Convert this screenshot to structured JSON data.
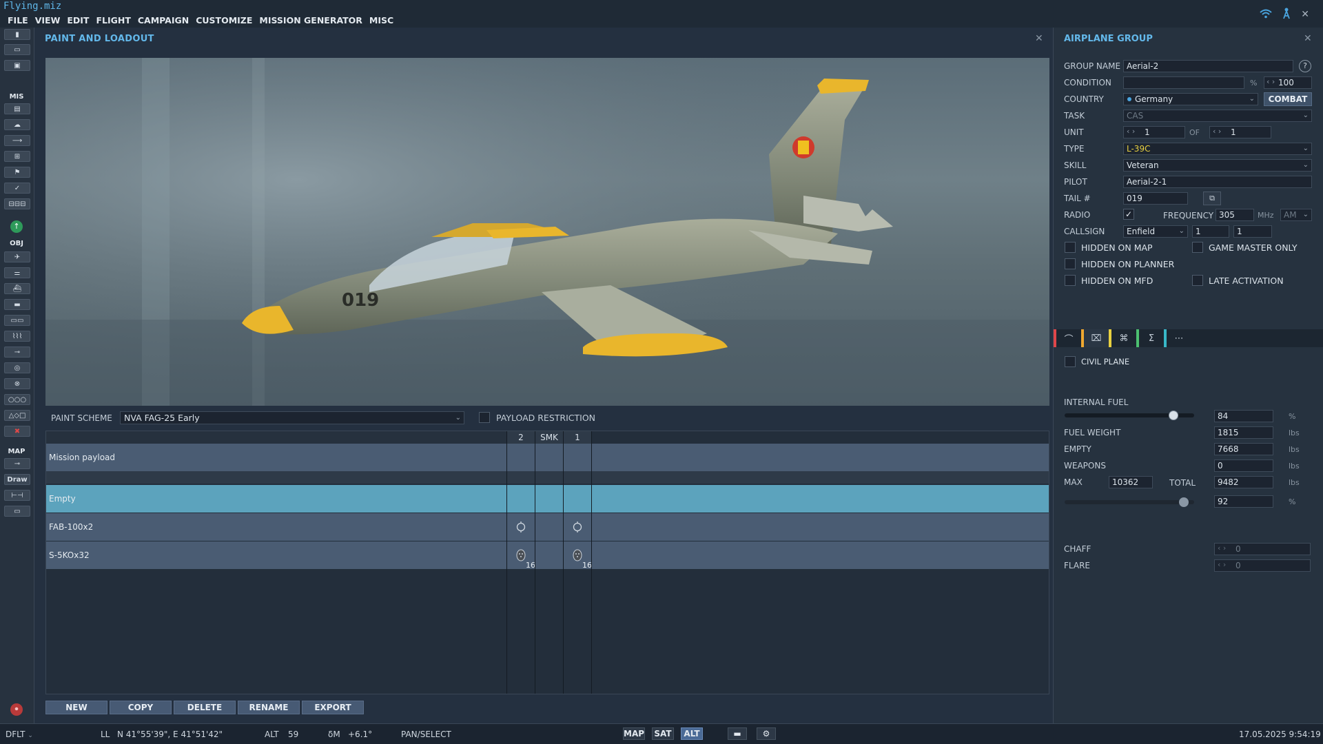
{
  "app": {
    "title": "Flying.miz"
  },
  "menu": [
    "FILE",
    "VIEW",
    "EDIT",
    "FLIGHT",
    "CAMPAIGN",
    "CUSTOMIZE",
    "MISSION GENERATOR",
    "MISC"
  ],
  "left_toolbar": {
    "mis_label": "MIS",
    "obj_label": "OBJ",
    "map_label": "MAP",
    "draw_label": "Draw"
  },
  "paint_loadout": {
    "title": "PAINT AND LOADOUT",
    "paint_scheme_label": "PAINT SCHEME",
    "paint_scheme_value": "NVA FAG-25 Early",
    "payload_restriction_label": "PAYLOAD RESTRICTION",
    "tail_marking": "019",
    "stations": [
      "2",
      "SMK",
      "1"
    ],
    "rows": [
      {
        "name": "Mission payload"
      },
      {
        "name": "Empty"
      },
      {
        "name": "FAB-100x2"
      },
      {
        "name": "S-5KOx32",
        "count_left": "16",
        "count_right": "16"
      }
    ],
    "buttons": [
      "NEW",
      "COPY",
      "DELETE",
      "RENAME",
      "EXPORT"
    ]
  },
  "group": {
    "title": "AIRPLANE GROUP",
    "group_name_label": "GROUP NAME",
    "group_name": "Aerial-2",
    "condition_label": "CONDITION",
    "condition_unit": "%",
    "condition_value": "100",
    "country_label": "COUNTRY",
    "country": "Germany",
    "combat_button": "COMBAT",
    "task_label": "TASK",
    "task": "CAS",
    "unit_label": "UNIT",
    "unit_value": "1",
    "of_label": "OF",
    "of_value": "1",
    "type_label": "TYPE",
    "type": "L-39C",
    "skill_label": "SKILL",
    "skill": "Veteran",
    "pilot_label": "PILOT",
    "pilot": "Aerial-2-1",
    "tail_label": "TAIL #",
    "tail": "019",
    "radio_label": "RADIO",
    "frequency_label": "FREQUENCY",
    "frequency": "305",
    "freq_unit": "MHz",
    "modulation": "AM",
    "callsign_label": "CALLSIGN",
    "callsign": "Enfield",
    "callsign_n1": "1",
    "callsign_n2": "1",
    "hidden_on_map": "HIDDEN ON MAP",
    "game_master_only": "GAME MASTER ONLY",
    "hidden_on_planner": "HIDDEN ON PLANNER",
    "hidden_on_mfd": "HIDDEN ON MFD",
    "late_activation": "LATE ACTIVATION",
    "civil_plane": "CIVIL PLANE",
    "internal_fuel_label": "INTERNAL FUEL",
    "internal_fuel": "84",
    "internal_fuel_fraction": 0.84,
    "fuel_weight_label": "FUEL WEIGHT",
    "fuel_weight": "1815",
    "empty_label": "EMPTY",
    "empty": "7668",
    "weapons_label": "WEAPONS",
    "weapons": "0",
    "max_label": "MAX",
    "max": "10362",
    "total_label": "TOTAL",
    "total": "9482",
    "total_pct": "92",
    "total_fraction": 0.92,
    "lbs": "lbs",
    "pct": "%",
    "chaff_label": "CHAFF",
    "chaff": "0",
    "flare_label": "FLARE",
    "flare": "0"
  },
  "tab_colors": [
    "#e0464a",
    "#f0a830",
    "#e8d040",
    "#4cc070",
    "#38b8c8"
  ],
  "status": {
    "profile": "DFLT",
    "ll_label": "LL",
    "coords": "N 41°55'39\", E 41°51'42\"",
    "alt_label": "ALT",
    "alt": "59",
    "dm_label": "δM",
    "dm": "+6.1°",
    "mode": "PAN/SELECT",
    "map_btn": "MAP",
    "sat_btn": "SAT",
    "alt_btn": "ALT",
    "datetime": "17.05.2025 9:54:19"
  }
}
